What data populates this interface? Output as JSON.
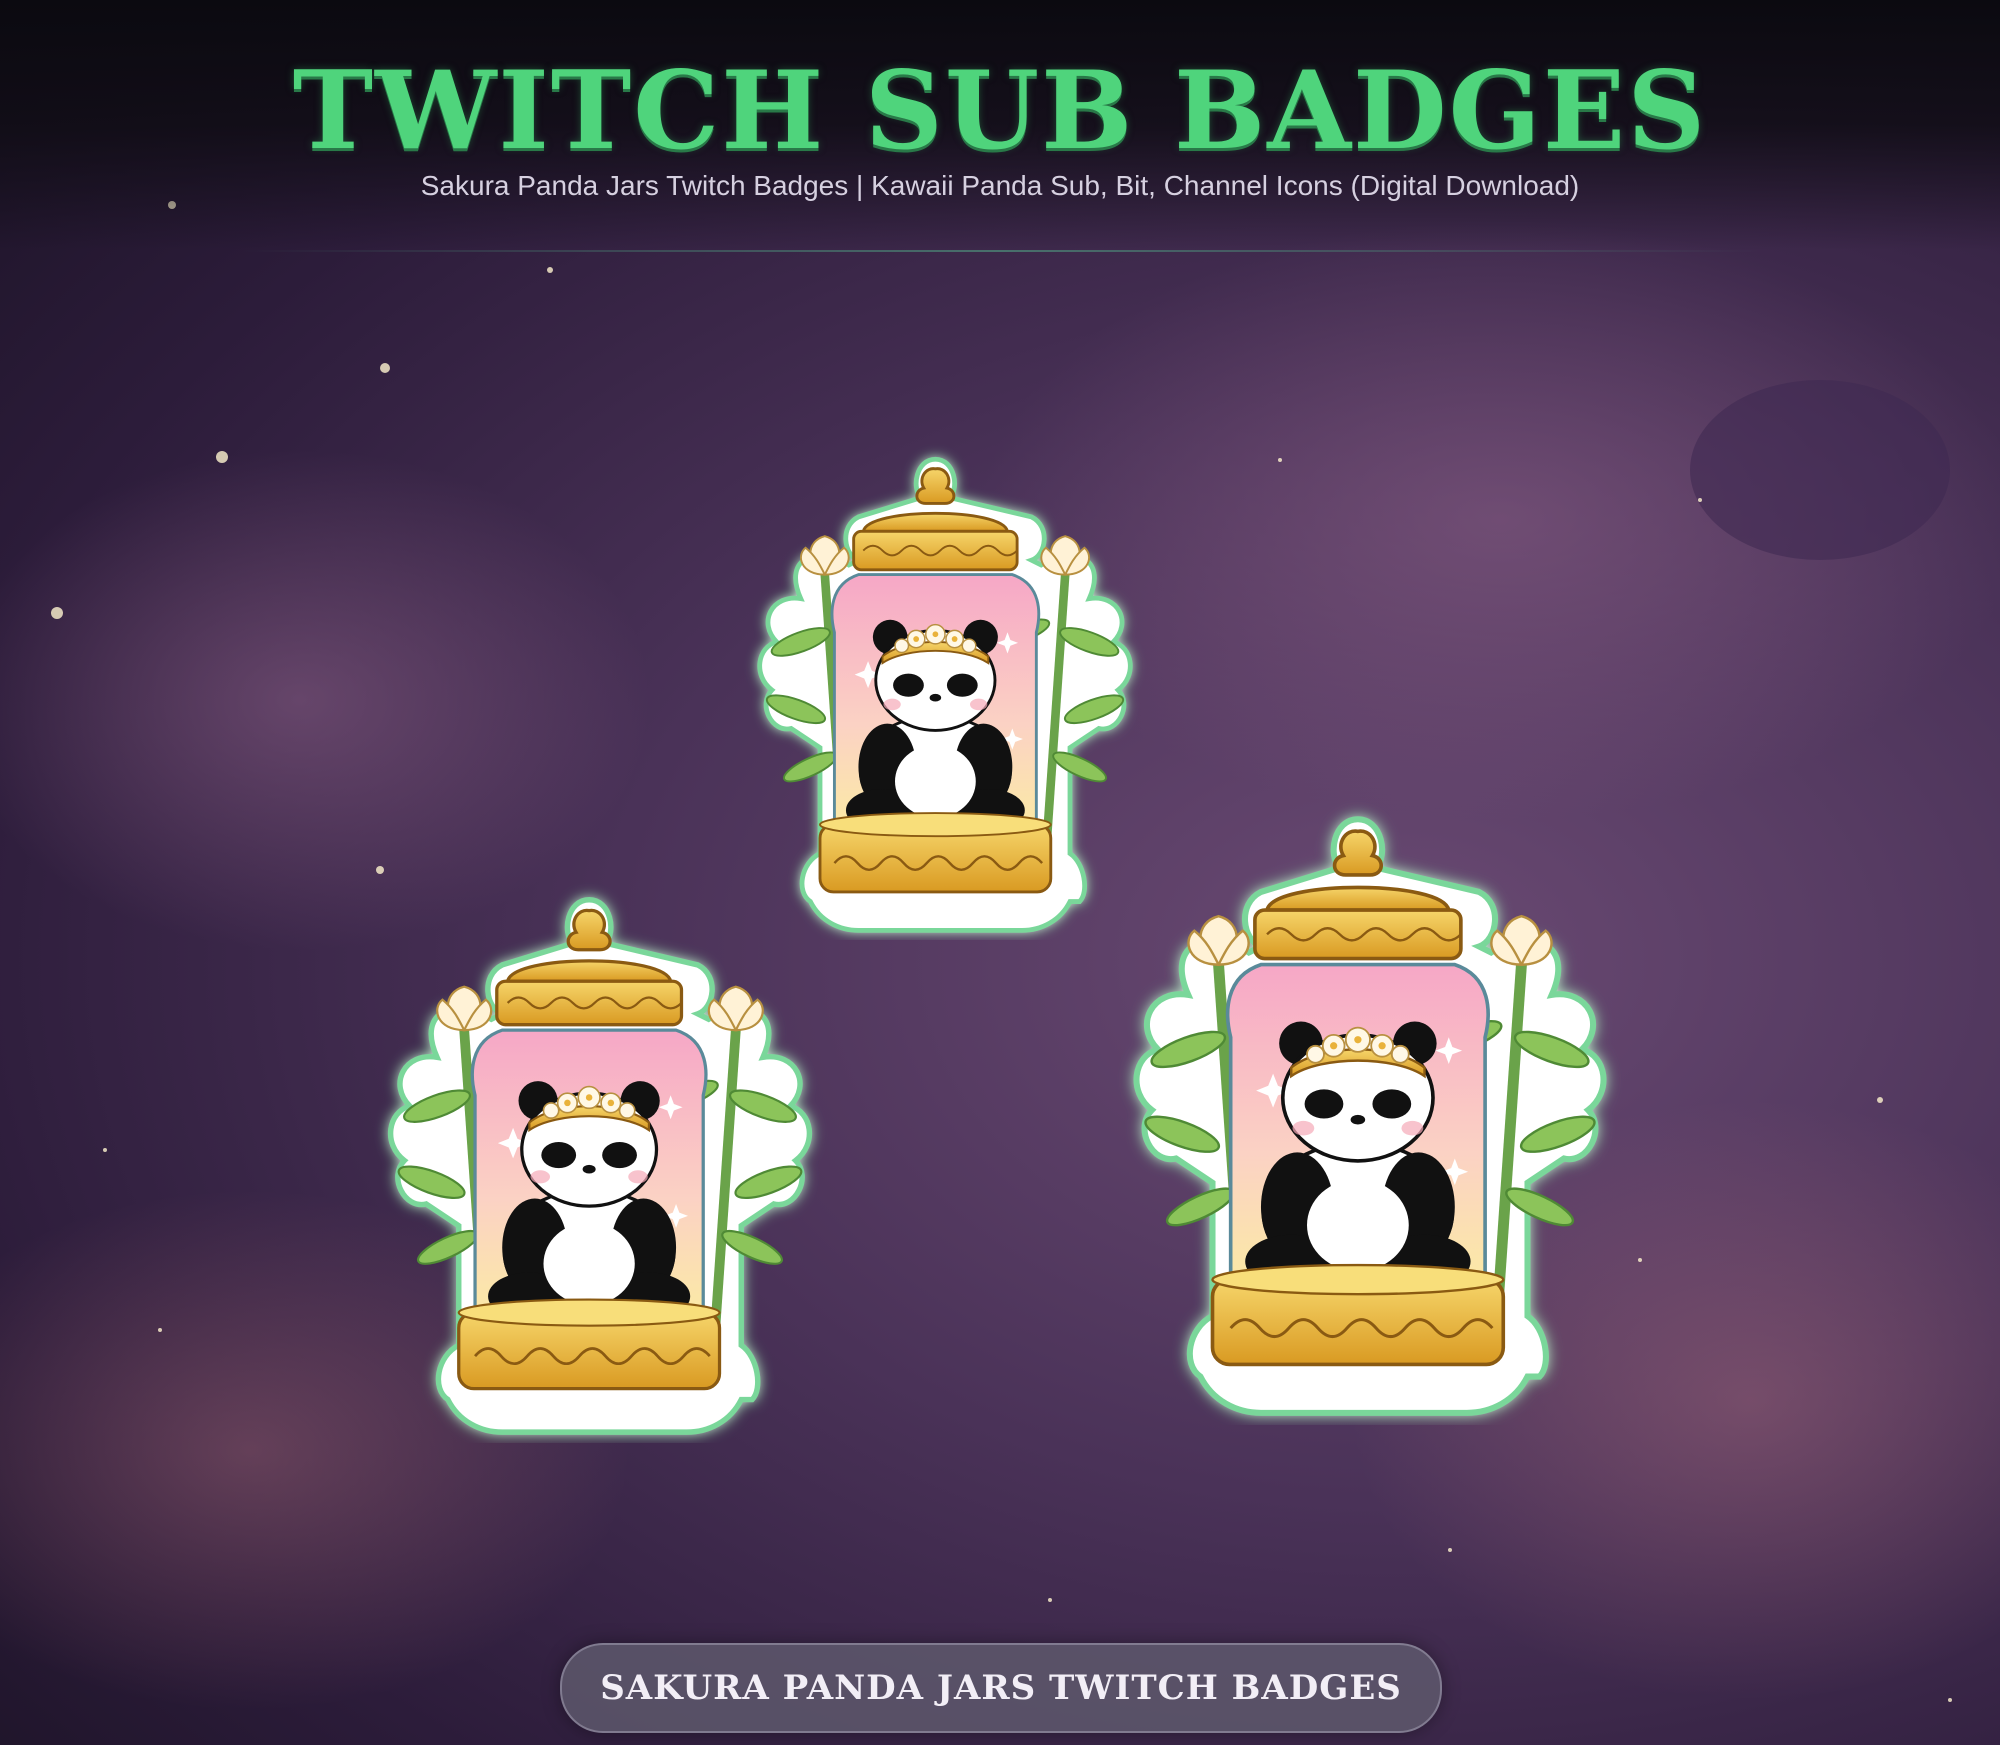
{
  "header": {
    "title": "TWITCH SUB BADGES",
    "subtitle": "Sakura Panda Jars Twitch Badges | Kawaii Panda Sub, Bit, Channel Icons (Digital Download)"
  },
  "badges": [
    {
      "name": "panda-jar-badge",
      "description_icon": "panda-jar-icon"
    },
    {
      "name": "panda-jar-badge",
      "description_icon": "panda-jar-icon"
    },
    {
      "name": "panda-jar-badge",
      "description_icon": "panda-jar-icon"
    }
  ],
  "footer": {
    "label": "SAKURA PANDA JARS TWITCH BADGES"
  },
  "colors": {
    "title_green": "#4fd47c",
    "jar_gold": "#e8b53a",
    "jar_pink": "#f7a9c4",
    "background_purple": "#4a3258"
  }
}
